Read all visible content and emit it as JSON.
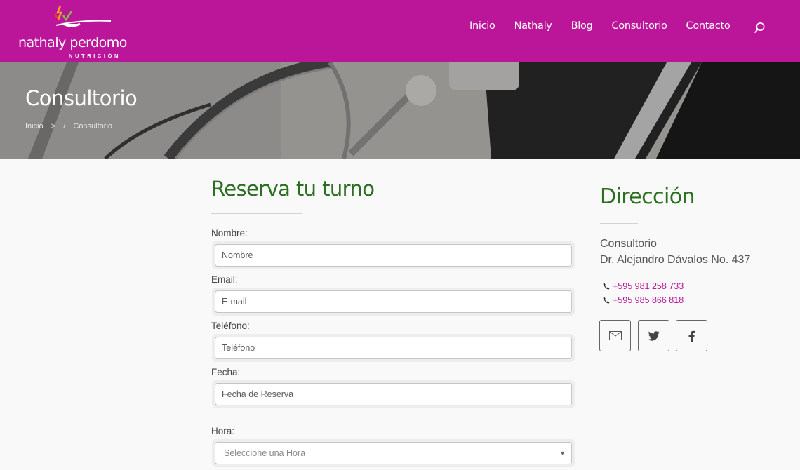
{
  "brand": {
    "name": "nathaly perdomo",
    "tagline": "NUTRICIÓN"
  },
  "nav": {
    "items": [
      "Inicio",
      "Nathaly",
      "Blog",
      "Consultorio",
      "Contacto"
    ]
  },
  "hero": {
    "title": "Consultorio",
    "breadcrumb": [
      "Inicio",
      ">",
      "/",
      "Consultorio"
    ]
  },
  "form": {
    "title": "Reserva tu turno",
    "fields": [
      {
        "label": "Nombre:",
        "placeholder": "Nombre"
      },
      {
        "label": "Email:",
        "placeholder": "E-mail"
      },
      {
        "label": "Teléfono:",
        "placeholder": "Teléfono"
      },
      {
        "label": "Fecha:",
        "placeholder": "Fecha de Reserva"
      }
    ],
    "hora": {
      "label": "Hora:",
      "selected": "Seleccione una Hora"
    }
  },
  "direccion": {
    "title": "Dirección",
    "lines": [
      "Consultorio",
      "Dr. Alejandro Dávalos No. 437"
    ],
    "phones": [
      "+595 981 258 733",
      "+595 985 866 818"
    ]
  },
  "colors": {
    "brand_magenta": "#bb1599",
    "heading_green": "#2a6e1f"
  },
  "icons": [
    "search-icon",
    "phone-icon",
    "envelope-icon",
    "twitter-icon",
    "facebook-icon"
  ]
}
